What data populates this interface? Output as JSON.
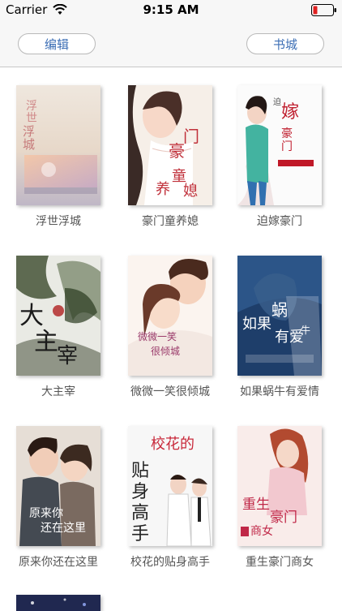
{
  "status_bar": {
    "carrier": "Carrier",
    "time": "9:15 AM"
  },
  "nav": {
    "edit_label": "编辑",
    "store_label": "书城"
  },
  "books": [
    {
      "title": "浮世浮城"
    },
    {
      "title": "豪门童养媳"
    },
    {
      "title": "迫嫁豪门"
    },
    {
      "title": "大主宰"
    },
    {
      "title": "微微一笑很倾城"
    },
    {
      "title": "如果蜗牛有爱情"
    },
    {
      "title": "原来你还在这里"
    },
    {
      "title": "校花的贴身高手"
    },
    {
      "title": "重生豪门商女"
    }
  ]
}
